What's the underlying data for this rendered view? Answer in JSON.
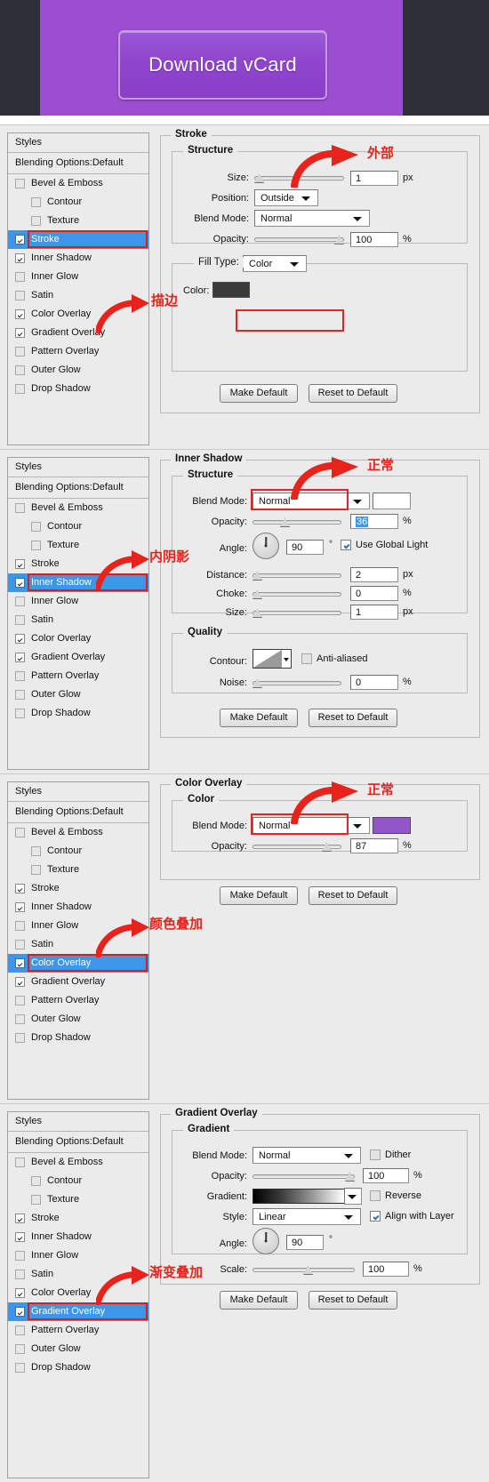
{
  "preview": {
    "button_label": "Download vCard",
    "purple": "#9b4ecf",
    "dark": "#2e3038"
  },
  "styles_panel": {
    "header": "Styles",
    "blending_options": "Blending Options:Default",
    "items": [
      {
        "label": "Bevel & Emboss",
        "indent": false
      },
      {
        "label": "Contour",
        "indent": true
      },
      {
        "label": "Texture",
        "indent": true
      },
      {
        "label": "Stroke",
        "indent": false
      },
      {
        "label": "Inner Shadow",
        "indent": false
      },
      {
        "label": "Inner Glow",
        "indent": false
      },
      {
        "label": "Satin",
        "indent": false
      },
      {
        "label": "Color Overlay",
        "indent": false
      },
      {
        "label": "Gradient Overlay",
        "indent": false
      },
      {
        "label": "Pattern Overlay",
        "indent": false
      },
      {
        "label": "Outer Glow",
        "indent": false
      },
      {
        "label": "Drop Shadow",
        "indent": false
      }
    ]
  },
  "common": {
    "make_default": "Make Default",
    "reset_to_default": "Reset to Default",
    "blend_mode_label": "Blend Mode:",
    "opacity_label": "Opacity:",
    "size_label": "Size:",
    "angle_label": "Angle:",
    "structure": "Structure",
    "normal": "Normal",
    "percent": "%",
    "px": "px",
    "degree": "°",
    "highlight_red": "#e8231b",
    "selection_blue": "#3d96e8"
  },
  "panel_stroke": {
    "title": "Stroke",
    "structure": "Structure",
    "size_label": "Size:",
    "size_value": "1",
    "size_unit": "px",
    "position_label": "Position:",
    "position_value": "Outside",
    "blend_mode_label": "Blend Mode:",
    "blend_mode_value": "Normal",
    "opacity_label": "Opacity:",
    "opacity_value": "100",
    "opacity_unit": "%",
    "fill_type_label": "Fill Type:",
    "fill_type_value": "Color",
    "color_label": "Color:",
    "color_value": "#3b3b3b",
    "annotation_right": "外部",
    "annotation_left": "描边",
    "selected_style": "Stroke"
  },
  "panel_inner_shadow": {
    "title": "Inner Shadow",
    "structure": "Structure",
    "blend_mode_label": "Blend Mode:",
    "blend_mode_value": "Normal",
    "opacity_label": "Opacity:",
    "opacity_value": "36",
    "opacity_unit": "%",
    "angle_label": "Angle:",
    "angle_value": "90",
    "angle_unit": "°",
    "use_global_light": "Use Global Light",
    "distance_label": "Distance:",
    "distance_value": "2",
    "distance_unit": "px",
    "choke_label": "Choke:",
    "choke_value": "0",
    "choke_unit": "%",
    "size_label": "Size:",
    "size_value": "1",
    "size_unit": "px",
    "quality": "Quality",
    "contour_label": "Contour:",
    "anti_aliased": "Anti-aliased",
    "noise_label": "Noise:",
    "noise_value": "0",
    "noise_unit": "%",
    "annotation_right": "正常",
    "annotation_left": "内阴影",
    "selected_style": "Inner Shadow"
  },
  "panel_color_overlay": {
    "title": "Color Overlay",
    "group": "Color",
    "blend_mode_label": "Blend Mode:",
    "blend_mode_value": "Normal",
    "color_swatch": "#9356c8",
    "opacity_label": "Opacity:",
    "opacity_value": "87",
    "opacity_unit": "%",
    "annotation_right": "正常",
    "annotation_left": "颜色叠加",
    "selected_style": "Color Overlay"
  },
  "panel_gradient_overlay": {
    "title": "Gradient Overlay",
    "group": "Gradient",
    "blend_mode_label": "Blend Mode:",
    "blend_mode_value": "Normal",
    "dither_label": "Dither",
    "opacity_label": "Opacity:",
    "opacity_value": "100",
    "opacity_unit": "%",
    "gradient_label": "Gradient:",
    "reverse_label": "Reverse",
    "style_label": "Style:",
    "style_value": "Linear",
    "align_with_layer": "Align with Layer",
    "angle_label": "Angle:",
    "angle_value": "90",
    "angle_unit": "°",
    "scale_label": "Scale:",
    "scale_value": "100",
    "scale_unit": "%",
    "annotation_left": "渐变叠加",
    "selected_style": "Gradient Overlay"
  }
}
